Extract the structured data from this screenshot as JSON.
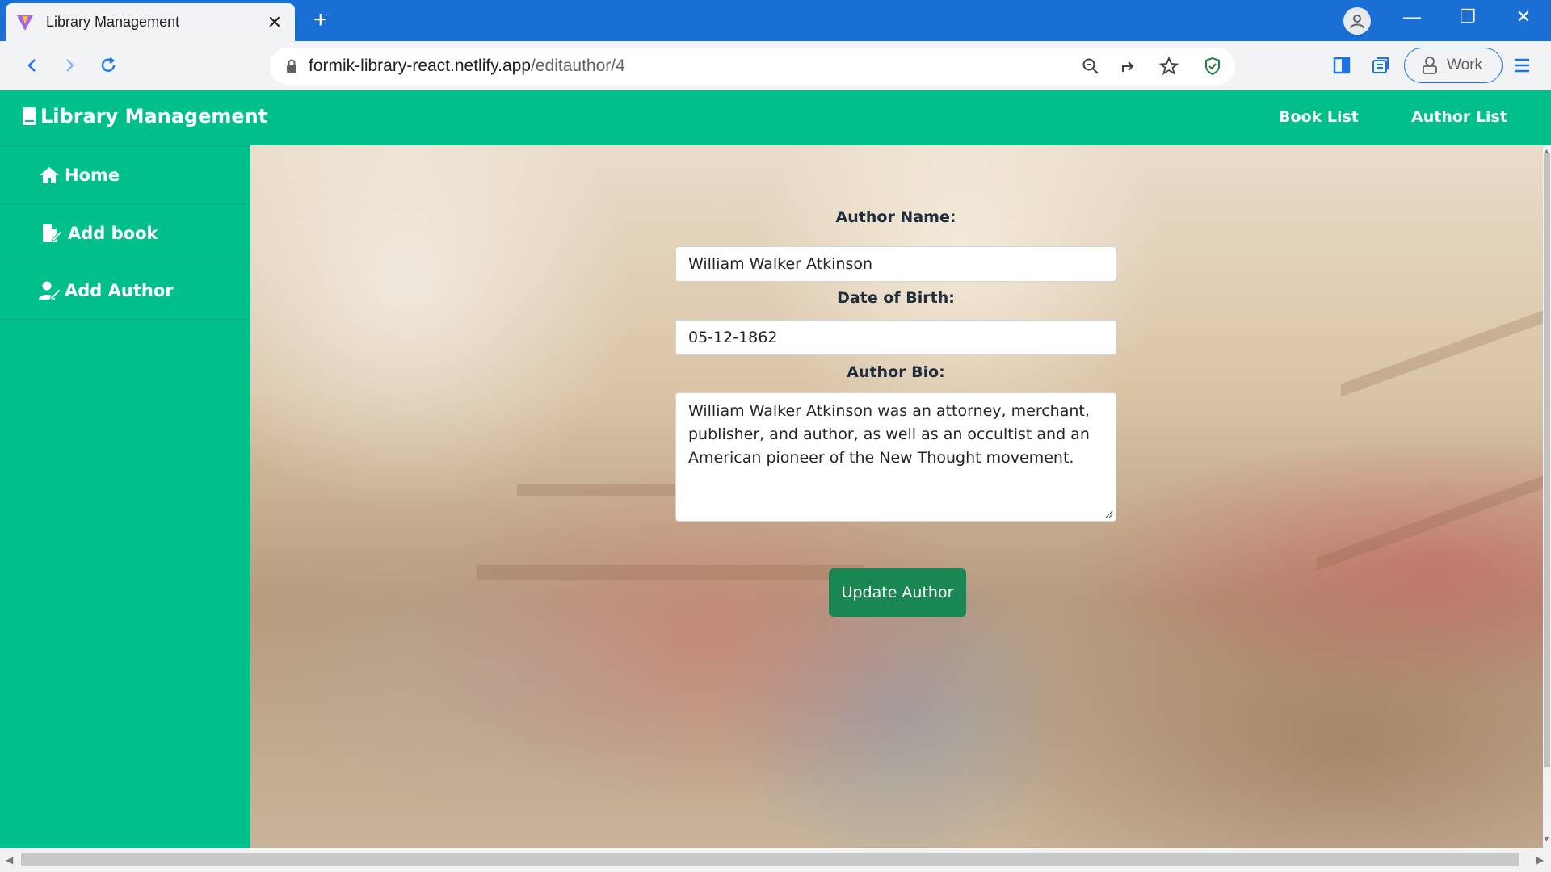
{
  "browser": {
    "tab_title": "Library Management",
    "url_host": "formik-library-react.netlify.app",
    "url_path": "/editauthor/4",
    "profile_label": "Work",
    "accent_color": "#1a6fd4"
  },
  "app": {
    "brand": "Library Management",
    "header_links": [
      "Book List",
      "Author List"
    ],
    "sidebar": [
      {
        "label": "Home",
        "icon": "home-icon"
      },
      {
        "label": "Add book",
        "icon": "file-edit-icon"
      },
      {
        "label": "Add Author",
        "icon": "user-edit-icon"
      }
    ],
    "theme_color": "#00bf8a"
  },
  "form": {
    "name_label": "Author Name:",
    "name_value": "William Walker Atkinson",
    "dob_label": "Date of Birth:",
    "dob_value": "05-12-1862",
    "bio_label": "Author Bio:",
    "bio_value": "William Walker Atkinson was an attorney, merchant, publisher, and author, as well as an occultist and an American pioneer of the New Thought movement.",
    "submit_label": "Update Author",
    "submit_color": "#198754"
  }
}
